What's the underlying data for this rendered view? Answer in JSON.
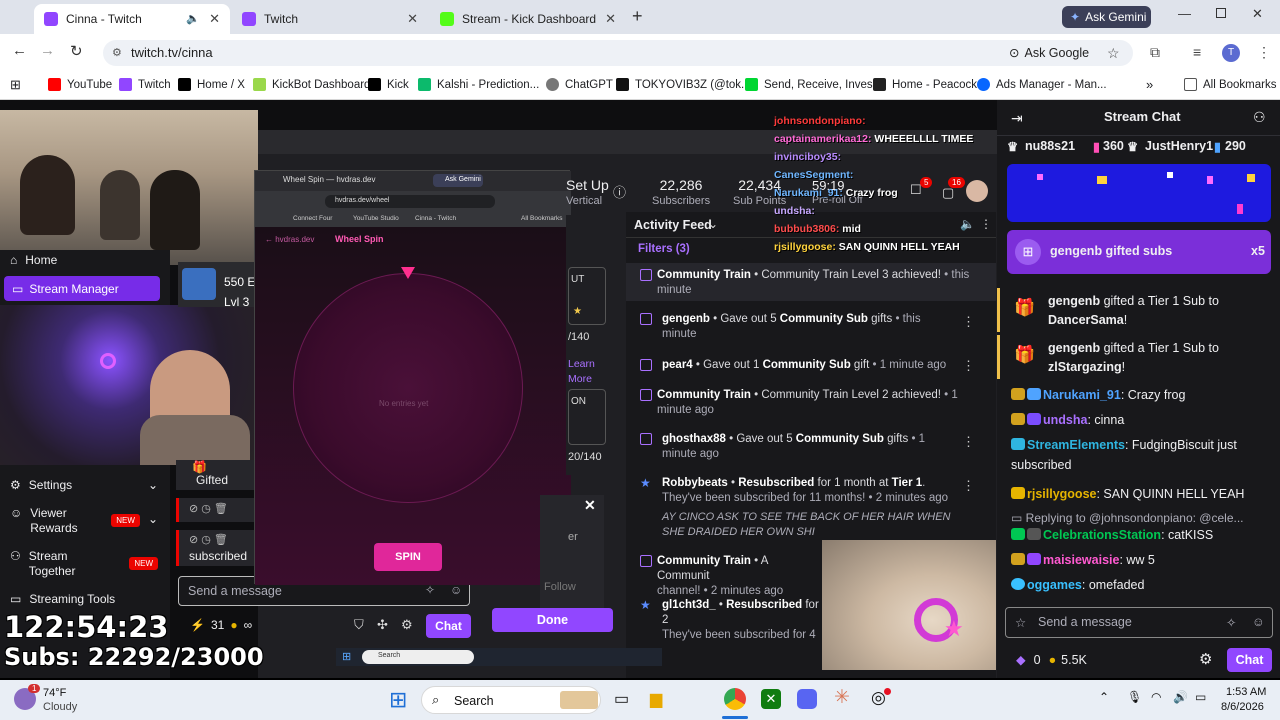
{
  "tabs": [
    {
      "title": "Cinna - Twitch",
      "color": "#9146ff"
    },
    {
      "title": "Twitch",
      "color": "#9146ff"
    },
    {
      "title": "Stream - Kick Dashboard",
      "color": "#53fc18"
    }
  ],
  "gemini_label": "Ask Gemini",
  "url": "twitch.tv/cinna",
  "ask_google": "Ask Google",
  "profile_initial": "T",
  "bookmarks": [
    "YouTube",
    "Twitch",
    "Home / X",
    "KickBot Dashboard",
    "Kick",
    "Kalshi - Prediction...",
    "ChatGPT",
    "TOKYOVIB3Z (@tok...",
    "Send, Receive, Inves...",
    "Home - Peacock",
    "Ads Manager - Man..."
  ],
  "all_bookmarks": "All Bookmarks",
  "left_menu": {
    "home": "Home",
    "stream_manager": "Stream Manager",
    "settings": "Settings",
    "viewer_rewards": "Viewer Rewards",
    "stream_together": "Stream Together",
    "new_badge": "NEW",
    "streaming_tools": "Streaming Tools"
  },
  "streamer_card": {
    "line1": "550 E",
    "line2": "Lvl 3"
  },
  "overlay": {
    "timer": "122:54:23",
    "subs": "Subs: 22292/23000"
  },
  "wheel_window": {
    "tab_title": "Wheel Spin — hvdras.dev",
    "ask_gemini": "Ask Gemini",
    "url": "hvdras.dev/wheel",
    "bookmarks": [
      "Connect Four",
      "YouTube Studio",
      "Cinna - Twitch"
    ],
    "all_bookmarks": "All Bookmarks",
    "back_link": "← hvdras.dev",
    "page_title": "Wheel Spin",
    "no_entries": "No entries yet",
    "spin": "SPIN"
  },
  "dash": {
    "setup_vertical_1": "Set Up",
    "setup_vertical_2": "Vertical",
    "subscribers_count": "22,286",
    "subscribers_label": "Subscribers",
    "subpoints_count": "22,434",
    "subpoints_label": "Sub Points",
    "timer_small": "59:19",
    "preroll": "Pre-roll Off",
    "notif_count": "5",
    "notif_count2": "16",
    "activity_feed": "Activity Feed",
    "filters": "Filters (3)",
    "goal_1": "/140",
    "goal_2": "20/140",
    "learn": "Learn",
    "more": "More",
    "ut": "UT",
    "on": "ON",
    "follow": "Follow",
    "done": "Done",
    "er": "er"
  },
  "feed": [
    {
      "name": "Community Train",
      "text": " • Community Train Level 3 achieved!",
      "time": " • this minute"
    },
    {
      "name": "gengenb",
      "text": " • Gave out 5 ",
      "bold": "Community Sub",
      "text2": " gifts",
      "time": " • this minute"
    },
    {
      "name": "pear4",
      "text": " • Gave out 1 ",
      "bold": "Community Sub",
      "text2": " gift",
      "time": " • 1 minute ago"
    },
    {
      "name": "Community Train",
      "text": " • Community Train Level 2 achieved!",
      "time": " • 1 minute ago"
    },
    {
      "name": "ghosthax88",
      "text": " • Gave out 5 ",
      "bold": "Community Sub",
      "text2": " gifts",
      "time": " • 1 minute ago"
    },
    {
      "name": "Robbybeats",
      "text": " • ",
      "bold": "Resubscribed",
      "text2": " for 1 month at ",
      "bold2": "Tier 1",
      "time": ". They've been subscribed for 11 months! • 2 minutes ago",
      "msg": "AY CINCO ASK TO SEE THE BACK OF HER HAIR WHEN SHE DRAIDED HER OWN SHI"
    },
    {
      "name": "Community Train",
      "text": " • A Communit",
      "time": "channel! • 2 minutes ago"
    },
    {
      "name": "gl1cht3d_",
      "text": " • ",
      "bold": "Resubscribed",
      "text2": " for 2",
      "time": "They've been subscribed for 4"
    }
  ],
  "overlay_chat": [
    {
      "user": "johnsondonpiano:",
      "msg": "",
      "color": "#ff3b3b"
    },
    {
      "user": "captainamerikaa12:",
      "msg": "WHEEELLLL TIMEE",
      "color": "#ff6bd6"
    },
    {
      "user": "invinciboy35:",
      "msg": "",
      "color": "#b98cff"
    },
    {
      "user": "CanesSegment:",
      "msg": "",
      "color": "#6fb6ff"
    },
    {
      "user": "Narukami_91:",
      "msg": "Crazy frog",
      "color": "#6fb6ff"
    },
    {
      "user": "undsha:",
      "msg": "",
      "color": "#c7a8ff"
    },
    {
      "user": "bubbub3806:",
      "msg": "mid",
      "color": "#ff4d4d"
    },
    {
      "user": "rjsillygoose:",
      "msg": "SAN QUINN HELL YEAH",
      "color": "#ffd33d"
    }
  ],
  "bottom_chat": {
    "placeholder": "Send a message",
    "points": "31",
    "chat_btn": "Chat",
    "gifted": "Gifted",
    "subscribed": "subscribed"
  },
  "stream_chat": {
    "title": "Stream Chat",
    "leader1_name": "nu88s21",
    "leader1_val": "360",
    "leader2_name": "JustHenry1",
    "leader2_val": "290",
    "gift_banner": "gengenb gifted subs",
    "gift_mult": "x5",
    "gift1_a": "gengenb",
    "gift1_b": " gifted a Tier 1 Sub to ",
    "gift1_c": "DancerSama",
    "gift1_d": "!",
    "gift2_a": "gengenb",
    "gift2_b": " gifted a Tier 1 Sub to ",
    "gift2_c": "zlStargazing",
    "gift2_d": "!",
    "messages": [
      {
        "user": "Narukami_91",
        "msg": ": Crazy frog",
        "color": "#4fa3ff"
      },
      {
        "user": "undsha",
        "msg": ": cinna",
        "color": "#a970ff"
      },
      {
        "user": "StreamElements",
        "msg": ": FudgingBiscuit just subscribed",
        "color": "#2fb5e0"
      },
      {
        "user": "rjsillygoose",
        "msg": ": SAN QUINN HELL YEAH",
        "color": "#e6b400"
      },
      {
        "user": "CelebrationsStation",
        "msg": ": catKISS",
        "color": "#00c853"
      },
      {
        "user": "maisiewaisie",
        "msg": ": ww 5",
        "color": "#ff5ad1"
      },
      {
        "user": "oggames",
        "msg": ": omefaded",
        "color": "#39c0ff"
      }
    ],
    "reply": "Replying to @johnsondonpiano: @cele...",
    "placeholder": "Send a message",
    "points_a": "0",
    "points_b": "5.5K",
    "chat_btn": "Chat"
  },
  "inner_taskbar_search": "Search",
  "taskbar": {
    "temp": "74°F",
    "weather": "Cloudy",
    "search": "Search",
    "time": "1:53 AM",
    "date": "8/6/2026",
    "weather_badge": "1"
  }
}
